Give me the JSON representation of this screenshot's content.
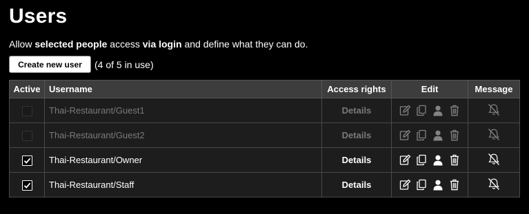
{
  "page": {
    "title": "Users",
    "intro": {
      "part1": "Allow ",
      "bold1": "selected people",
      "part2": " access ",
      "bold2": "via login",
      "part3": " and define what they can do."
    },
    "create_button": "Create new user",
    "usage": "(4 of 5 in use)"
  },
  "table": {
    "headers": {
      "active": "Active",
      "username": "Username",
      "access": "Access rights",
      "edit": "Edit",
      "message": "Message"
    },
    "rows": [
      {
        "active": false,
        "username": "Thai-Restaurant/Guest1",
        "access": "Details",
        "enabled": false
      },
      {
        "active": false,
        "username": "Thai-Restaurant/Guest2",
        "access": "Details",
        "enabled": false
      },
      {
        "active": true,
        "username": "Thai-Restaurant/Owner",
        "access": "Details",
        "enabled": true
      },
      {
        "active": true,
        "username": "Thai-Restaurant/Staff",
        "access": "Details",
        "enabled": true
      }
    ]
  },
  "icons": {
    "edit": "edit-icon",
    "copy": "copy-icon",
    "user": "user-icon",
    "delete": "trash-icon",
    "message": "bell-off-icon",
    "checkbox": "checkmark-icon"
  }
}
